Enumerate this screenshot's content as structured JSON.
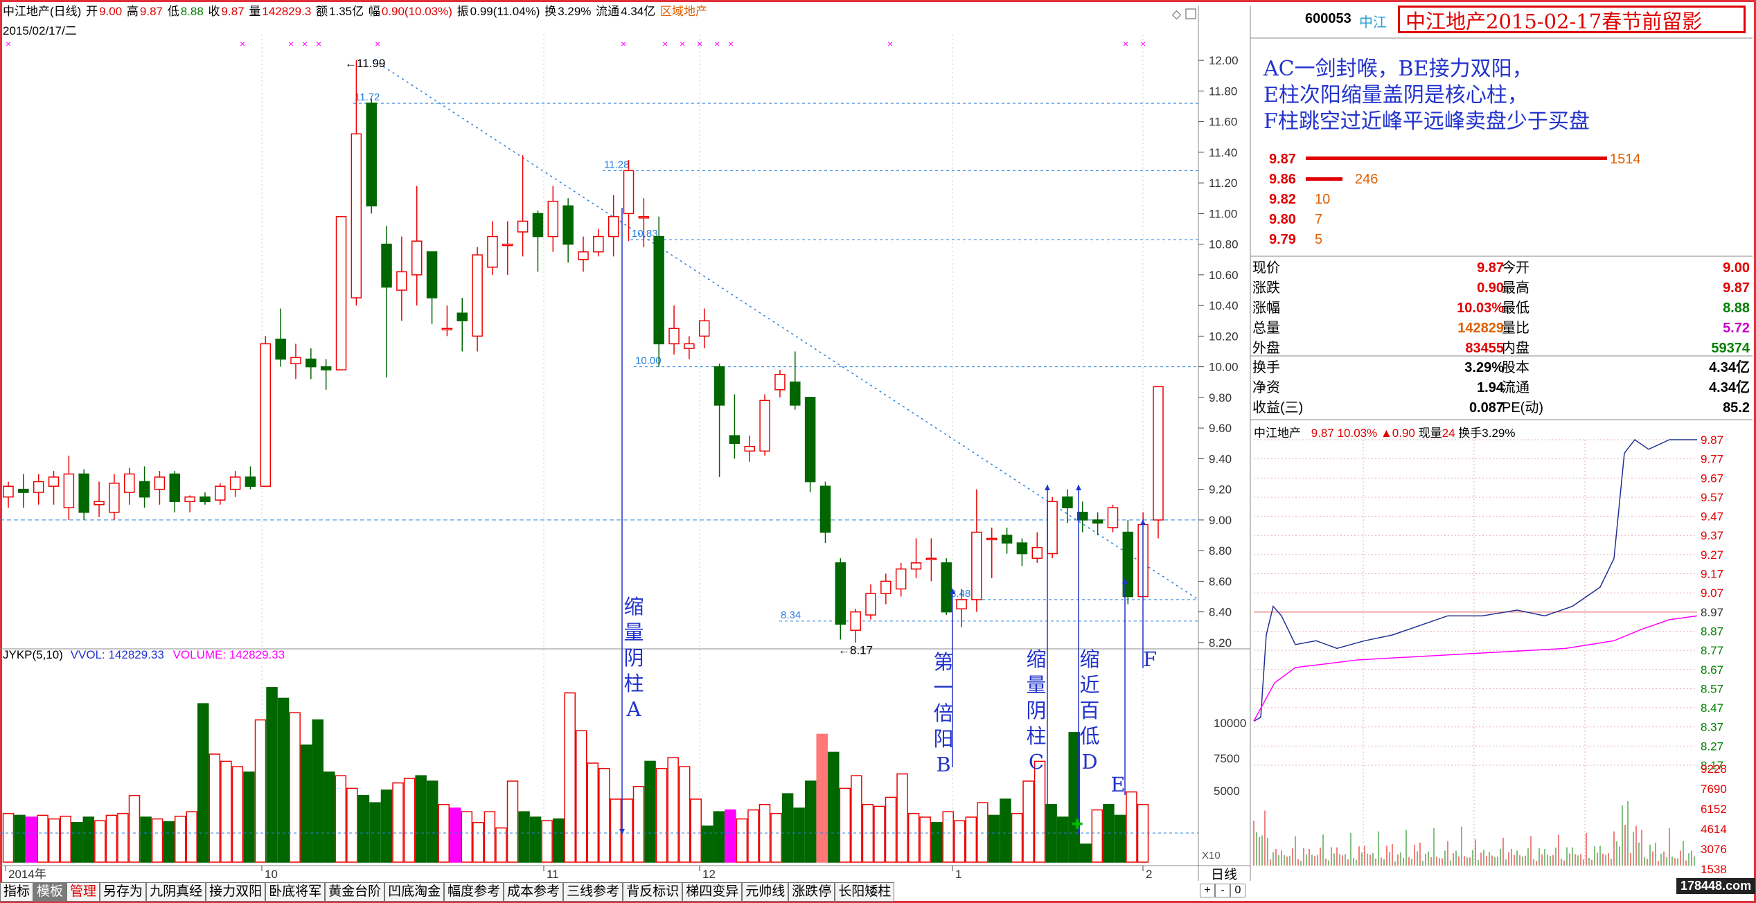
{
  "header": {
    "name": "中江地产(日线)",
    "open_label": "开",
    "open": "9.00",
    "high_label": "高",
    "high": "9.87",
    "low_label": "低",
    "low": "8.88",
    "close_label": "收",
    "close": "9.87",
    "vol_label": "量",
    "vol": "142829.3",
    "amount_label": "额",
    "amount": "1.35亿",
    "change_label": "幅",
    "change": "0.90(10.03%)",
    "amp_label": "振",
    "amp": "0.99(11.04%)",
    "turn_label": "换",
    "turn": "3.29%",
    "float_label": "流通",
    "float": "4.34亿",
    "region": "区域地产",
    "date": "2015/02/17/二"
  },
  "price_axis": [
    "12.00",
    "11.80",
    "11.60",
    "11.40",
    "11.20",
    "11.00",
    "10.80",
    "10.60",
    "10.40",
    "10.20",
    "10.00",
    "9.80",
    "9.60",
    "9.40",
    "9.20",
    "9.00",
    "8.80",
    "8.60",
    "8.40",
    "8.20"
  ],
  "price_marks": {
    "p1199": "11.99",
    "p1172": "11.72",
    "p1128": "11.28",
    "p1083": "10.83",
    "p1000": "10.00",
    "p834": "8.34",
    "p848": "8.48",
    "p817": "8.17"
  },
  "volume": {
    "legend_name": "JYKP(5,10)",
    "vvol": "VVOL: 142829.33",
    "volume": "VOLUME: 142829.33",
    "axis": [
      "10000",
      "7500",
      "5000"
    ],
    "x10": "X10"
  },
  "date_axis": [
    "2014年",
    "10",
    "11",
    "12",
    "1",
    "2"
  ],
  "colors": {
    "up": "#ee0000",
    "down": "#006600",
    "axis": "#444444",
    "dash": "#2a7fdd",
    "note": "#2233cc",
    "accent": "#e06000",
    "mag": "#ff00ff"
  },
  "chart_data": {
    "type": "candlestick",
    "title": "中江地产(日线)",
    "ylim": [
      8.1,
      12.1
    ],
    "candles": [
      [
        9.15,
        9.22,
        9.08,
        9.25
      ],
      [
        9.2,
        9.18,
        9.08,
        9.3
      ],
      [
        9.18,
        9.25,
        9.1,
        9.3
      ],
      [
        9.22,
        9.28,
        9.1,
        9.32
      ],
      [
        9.08,
        9.3,
        9.0,
        9.42
      ],
      [
        9.3,
        9.05,
        9.0,
        9.33
      ],
      [
        9.1,
        9.12,
        9.02,
        9.25
      ],
      [
        9.05,
        9.24,
        9.0,
        9.3
      ],
      [
        9.18,
        9.3,
        9.1,
        9.34
      ],
      [
        9.25,
        9.15,
        9.08,
        9.35
      ],
      [
        9.2,
        9.28,
        9.1,
        9.32
      ],
      [
        9.3,
        9.12,
        9.05,
        9.32
      ],
      [
        9.12,
        9.15,
        9.05,
        9.16
      ],
      [
        9.15,
        9.12,
        9.1,
        9.18
      ],
      [
        9.13,
        9.22,
        9.1,
        9.24
      ],
      [
        9.2,
        9.28,
        9.15,
        9.32
      ],
      [
        9.28,
        9.22,
        9.2,
        9.35
      ],
      [
        9.22,
        10.15,
        9.22,
        10.2
      ],
      [
        10.18,
        10.05,
        10.0,
        10.38
      ],
      [
        10.02,
        10.06,
        9.92,
        10.15
      ],
      [
        10.05,
        10.0,
        9.92,
        10.12
      ],
      [
        10.0,
        9.98,
        9.85,
        10.05
      ],
      [
        9.98,
        10.98,
        9.98,
        10.55
      ],
      [
        10.45,
        11.52,
        10.4,
        12.0
      ],
      [
        11.72,
        11.05,
        11.0,
        11.75
      ],
      [
        10.8,
        10.52,
        9.93,
        10.92
      ],
      [
        10.5,
        10.62,
        10.3,
        10.85
      ],
      [
        10.6,
        10.82,
        10.4,
        11.18
      ],
      [
        10.75,
        10.45,
        10.28,
        10.75
      ],
      [
        10.25,
        10.25,
        10.2,
        10.4
      ],
      [
        10.35,
        10.3,
        10.1,
        10.45
      ],
      [
        10.2,
        10.73,
        10.1,
        10.78
      ],
      [
        10.65,
        10.85,
        10.6,
        10.95
      ],
      [
        10.8,
        10.8,
        10.6,
        10.95
      ],
      [
        10.88,
        10.95,
        10.72,
        11.38
      ],
      [
        11.0,
        10.85,
        10.62,
        11.02
      ],
      [
        10.85,
        11.08,
        10.75,
        11.18
      ],
      [
        11.05,
        10.8,
        10.68,
        11.1
      ],
      [
        10.7,
        10.75,
        10.62,
        10.85
      ],
      [
        10.75,
        10.85,
        10.72,
        10.9
      ],
      [
        10.85,
        10.98,
        10.72,
        11.12
      ],
      [
        11.0,
        11.28,
        10.82,
        11.35
      ],
      [
        10.98,
        10.98,
        10.78,
        11.1
      ],
      [
        10.85,
        10.15,
        10.0,
        10.98
      ],
      [
        10.15,
        10.25,
        10.08,
        10.4
      ],
      [
        10.12,
        10.15,
        10.05,
        10.2
      ],
      [
        10.2,
        10.3,
        10.12,
        10.38
      ],
      [
        10.0,
        9.75,
        9.28,
        10.02
      ],
      [
        9.55,
        9.5,
        9.4,
        9.82
      ],
      [
        9.45,
        9.48,
        9.38,
        9.55
      ],
      [
        9.45,
        9.78,
        9.42,
        9.82
      ],
      [
        9.85,
        9.95,
        9.8,
        9.98
      ],
      [
        9.9,
        9.75,
        9.72,
        10.1
      ],
      [
        9.8,
        9.25,
        9.18,
        9.8
      ],
      [
        9.22,
        8.92,
        8.85,
        9.25
      ],
      [
        8.72,
        8.32,
        8.22,
        8.75
      ],
      [
        8.28,
        8.4,
        8.2,
        8.42
      ],
      [
        8.38,
        8.52,
        8.35,
        8.58
      ],
      [
        8.52,
        8.6,
        8.45,
        8.65
      ],
      [
        8.55,
        8.68,
        8.5,
        8.72
      ],
      [
        8.68,
        8.72,
        8.62,
        8.88
      ],
      [
        8.75,
        8.75,
        8.6,
        8.88
      ],
      [
        8.72,
        8.4,
        8.38,
        8.75
      ],
      [
        8.42,
        8.48,
        8.3,
        8.55
      ],
      [
        8.48,
        8.92,
        8.4,
        9.2
      ],
      [
        8.88,
        8.88,
        8.62,
        8.95
      ],
      [
        8.9,
        8.85,
        8.78,
        8.95
      ],
      [
        8.85,
        8.78,
        8.7,
        8.88
      ],
      [
        8.75,
        8.82,
        8.72,
        8.92
      ],
      [
        8.78,
        9.12,
        8.75,
        9.15
      ],
      [
        9.15,
        9.08,
        8.98,
        9.2
      ],
      [
        9.05,
        9.0,
        8.92,
        9.12
      ],
      [
        9.0,
        8.98,
        8.9,
        9.05
      ],
      [
        8.95,
        9.08,
        8.92,
        9.1
      ],
      [
        8.92,
        8.5,
        8.45,
        9.0
      ],
      [
        8.5,
        8.97,
        8.5,
        9.05
      ],
      [
        9.0,
        9.87,
        8.88,
        9.87
      ]
    ],
    "volumes": [
      2700,
      2600,
      2500,
      2600,
      2400,
      2550,
      2200,
      2500,
      2300,
      2600,
      2700,
      3700,
      2500,
      2400,
      2250,
      2550,
      2800,
      8800,
      6000,
      5600,
      5300,
      5000,
      7900,
      9700,
      9100,
      8300,
      6500,
      7900,
      5000,
      4800,
      4100,
      3700,
      3300,
      4000,
      4400,
      4650,
      4800,
      4500,
      3200,
      3000,
      2800,
      2200,
      2800,
      1900,
      4500,
      2800,
      2500,
      2300,
      2400,
      9400,
      7300,
      5500,
      5200,
      3500,
      3500,
      4200,
      5600,
      5200,
      5800,
      5300,
      3500,
      2000,
      2800,
      2900,
      2400,
      2900,
      3200,
      2700,
      3800,
      3000,
      4500,
      7100,
      6100,
      4100,
      4800,
      3200,
      3100,
      3600,
      4900,
      2700,
      2500,
      2200,
      2800,
      2300,
      2500,
      3300,
      2600,
      3500,
      2700,
      4500,
      5600,
      3200,
      2500,
      7200,
      1000,
      2900,
      3200,
      2600,
      3900,
      3200
    ]
  },
  "right": {
    "code": "600053",
    "code_name": "中江",
    "title_banner": "中江地产2015-02-17春节前留影",
    "note_lines": [
      "AC一剑封喉，BE接力双阳，",
      "E柱次阳缩量盖阴是核心柱，",
      "F柱跳空过近峰平远峰卖盘少于买盘"
    ],
    "bids": [
      {
        "p": "9.87",
        "v": "1514"
      },
      {
        "p": "9.86",
        "v": "246"
      },
      {
        "p": "9.82",
        "v": "10"
      },
      {
        "p": "9.80",
        "v": "7"
      },
      {
        "p": "9.79",
        "v": "5"
      }
    ],
    "quote_rows": [
      {
        "l1": "现价",
        "v1": "9.87",
        "l2": "今开",
        "v2": "9.00"
      },
      {
        "l1": "涨跌",
        "v1": "0.90",
        "l2": "最高",
        "v2": "9.87"
      },
      {
        "l1": "涨幅",
        "v1": "10.03%",
        "l2": "最低",
        "v2": "8.88"
      },
      {
        "l1": "总量",
        "v1": "142829",
        "l2": "量比",
        "v2": "5.72"
      },
      {
        "l1": "外盘",
        "v1": "83455",
        "l2": "内盘",
        "v2": "59374"
      }
    ],
    "quote_rows2": [
      {
        "l1": "换手",
        "v1": "3.29%",
        "l2": "股本",
        "v2": "4.34亿"
      },
      {
        "l1": "净资",
        "v1": "1.94",
        "l2": "流通",
        "v2": "4.34亿"
      },
      {
        "l1": "收益(三)",
        "v1": "0.087",
        "l2": "PE(动)",
        "v2": "85.2"
      }
    ],
    "intraday": {
      "name": "中江地产",
      "price": "9.87",
      "pct": "10.03%",
      "chg": "▲0.90",
      "now_label": "现量",
      "now": "24",
      "turn_label": "换手",
      "turn": "3.29%",
      "axis": [
        "9.87",
        "9.77",
        "9.67",
        "9.57",
        "9.47",
        "9.37",
        "9.27",
        "9.17",
        "9.07",
        "8.97",
        "8.87",
        "8.77",
        "8.67",
        "8.57",
        "8.47",
        "8.37",
        "8.27",
        "8.17"
      ],
      "vol_axis": [
        "9228",
        "7690",
        "6152",
        "4614",
        "3076",
        "1538"
      ]
    },
    "watermark": "178448.com"
  },
  "annotations": {
    "A": [
      "缩",
      "量",
      "阴",
      "柱",
      "A"
    ],
    "B": [
      "第",
      "一",
      "倍",
      "阳",
      "B"
    ],
    "C": [
      "缩",
      "量",
      "阴",
      "柱",
      "C"
    ],
    "D": [
      "缩",
      "近",
      "百",
      "低",
      "D"
    ],
    "E": "E",
    "F": "F"
  },
  "tabs": [
    "指标",
    "模板",
    "管理",
    "另存为",
    "九阴真经",
    "接力双阳",
    "卧底将军",
    "黄金台阶",
    "凹底淘金",
    "幅度参考",
    "成本参考",
    "三线参考",
    "背反标识",
    "梯四变异",
    "元帅线",
    "涨跌停",
    "长阳矮柱"
  ],
  "bottom_right": {
    "period": "日线",
    "plus": "+",
    "minus": "-",
    "zero": "0"
  }
}
